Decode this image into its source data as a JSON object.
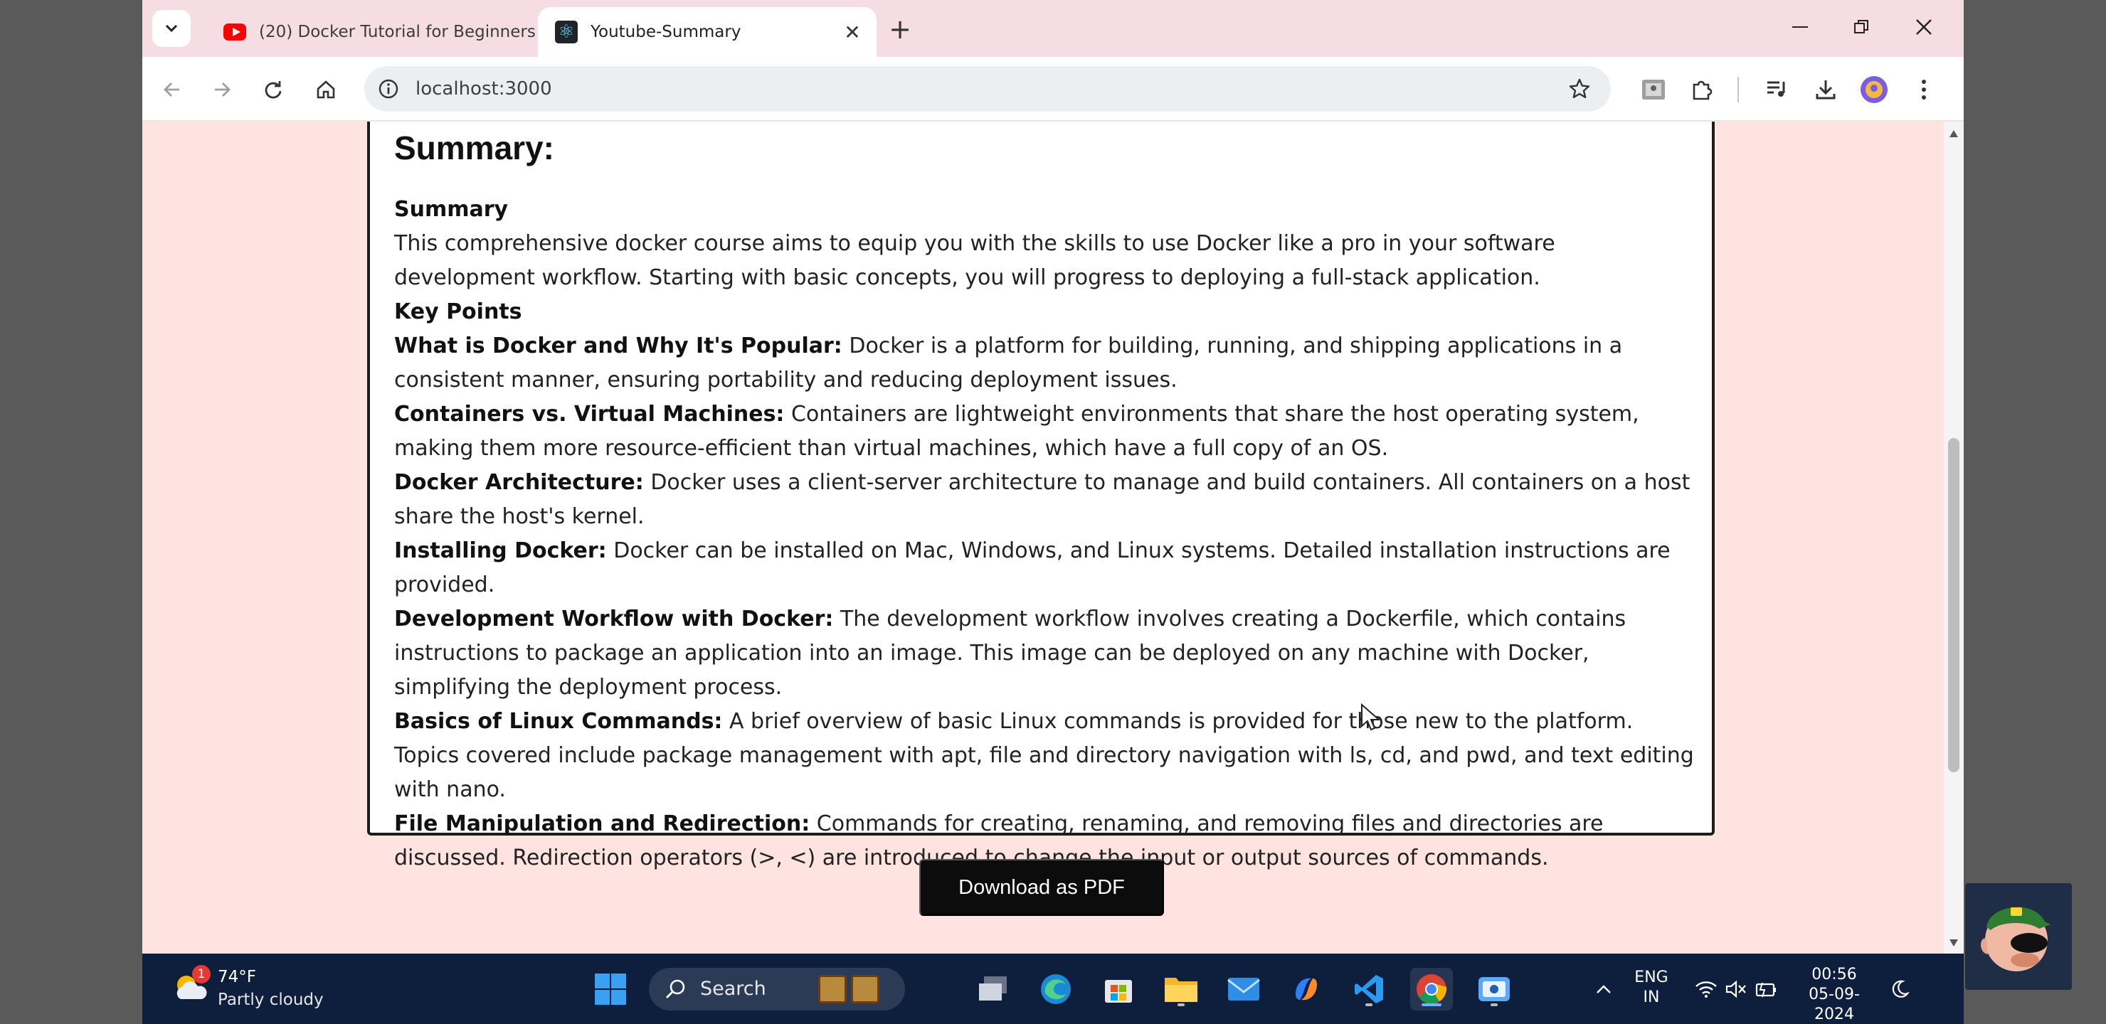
{
  "browser": {
    "tabs": [
      {
        "title": "(20) Docker Tutorial for Beginners",
        "favicon": "youtube-icon",
        "active": false
      },
      {
        "title": "Youtube-Summary",
        "favicon": "react-icon",
        "active": true
      }
    ],
    "url": "localhost:3000"
  },
  "page": {
    "heading": "Summary:",
    "summary_label": "Summary",
    "summary_text": "This comprehensive docker course aims to equip you with the skills to use Docker like a pro in your software development workflow. Starting with basic concepts, you will progress to deploying a full-stack application.",
    "key_points_label": "Key Points",
    "key_points": [
      {
        "title": "What is Docker and Why It's Popular:",
        "text": "Docker is a platform for building, running, and shipping applications in a consistent manner, ensuring portability and reducing deployment issues."
      },
      {
        "title": "Containers vs. Virtual Machines:",
        "text": "Containers are lightweight environments that share the host operating system, making them more resource-efficient than virtual machines, which have a full copy of an OS."
      },
      {
        "title": "Docker Architecture:",
        "text": "Docker uses a client-server architecture to manage and build containers. All containers on a host share the host's kernel."
      },
      {
        "title": "Installing Docker:",
        "text": "Docker can be installed on Mac, Windows, and Linux systems. Detailed installation instructions are provided."
      },
      {
        "title": "Development Workflow with Docker:",
        "text": "The development workflow involves creating a Dockerfile, which contains instructions to package an application into an image. This image can be deployed on any machine with Docker, simplifying the deployment process."
      },
      {
        "title": "Basics of Linux Commands:",
        "text": "A brief overview of basic Linux commands is provided for those new to the platform. Topics covered include package management with apt, file and directory navigation with ls, cd, and pwd, and text editing with nano."
      },
      {
        "title": "File Manipulation and Redirection:",
        "text": "Commands for creating, renaming, and removing files and directories are discussed. Redirection operators (>, <) are introduced to change the input or output sources of commands."
      }
    ],
    "download_button": "Download as PDF"
  },
  "taskbar": {
    "weather": {
      "temp": "74°F",
      "condition": "Partly cloudy",
      "badge": "1"
    },
    "search_label": "Search",
    "apps": [
      "start-icon",
      "task-view-icon",
      "edge-icon",
      "store-icon",
      "file-explorer-icon",
      "mail-icon",
      "copilot-icon",
      "vscode-icon",
      "chrome-icon",
      "screen-recorder-icon"
    ],
    "language": {
      "line1": "ENG",
      "line2": "IN"
    },
    "time": "00:56",
    "date": "05-09-2024"
  },
  "colors": {
    "page_background": "#ffe3e0",
    "tab_strip": "#f6dde3",
    "button_background": "#0c0c0c",
    "taskbar": "#0e1f3d"
  }
}
